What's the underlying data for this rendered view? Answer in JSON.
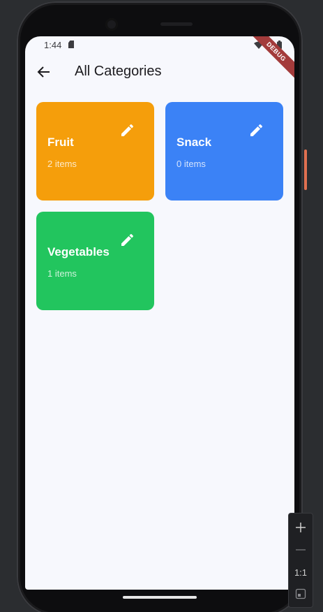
{
  "status_bar": {
    "time": "1:44",
    "debug_banner": "DEBUG"
  },
  "app_bar": {
    "title": "All Categories",
    "back_icon": "arrow-back-icon"
  },
  "categories": [
    {
      "name": "Fruit",
      "count": "2 items",
      "color": "#f59e0b",
      "icon": "pencil-icon"
    },
    {
      "name": "Snack",
      "count": "0 items",
      "color": "#3b82f6",
      "icon": "pencil-icon"
    },
    {
      "name": "Vegetables",
      "count": "1 items",
      "color": "#22c55e",
      "icon": "pencil-icon"
    }
  ],
  "emulator_controls": {
    "zoom_in": "+",
    "zoom_out": "—",
    "actual_size": "1:1"
  }
}
